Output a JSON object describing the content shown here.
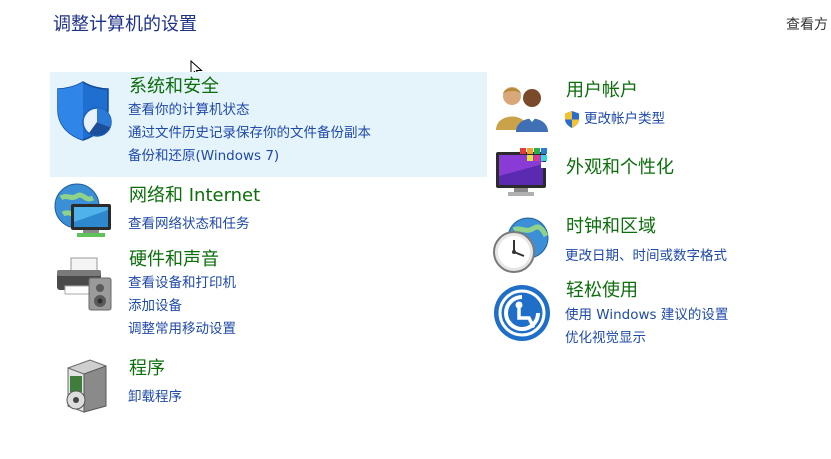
{
  "header": {
    "title": "调整计算机的设置",
    "view_by": "查看方"
  },
  "left": [
    {
      "title": "系统和安全",
      "icon": "security-shield-icon",
      "links": [
        "查看你的计算机状态",
        "通过文件历史记录保存你的文件备份副本",
        "备份和还原(Windows 7)"
      ]
    },
    {
      "title": "网络和 Internet",
      "icon": "network-globe-icon",
      "links": [
        "查看网络状态和任务"
      ]
    },
    {
      "title": "硬件和声音",
      "icon": "printer-speaker-icon",
      "links": [
        "查看设备和打印机",
        "添加设备",
        "调整常用移动设置"
      ]
    },
    {
      "title": "程序",
      "icon": "programs-box-icon",
      "links": [
        "卸载程序"
      ]
    }
  ],
  "right": [
    {
      "title": "用户帐户",
      "icon": "user-accounts-icon",
      "links": [
        "更改帐户类型"
      ]
    },
    {
      "title": "外观和个性化",
      "icon": "appearance-monitor-icon",
      "links": []
    },
    {
      "title": "时钟和区域",
      "icon": "clock-globe-icon",
      "links": [
        "更改日期、时间或数字格式"
      ]
    },
    {
      "title": "轻松使用",
      "icon": "ease-of-access-icon",
      "links": [
        "使用 Windows 建议的设置",
        "优化视觉显示"
      ]
    }
  ],
  "colors": {
    "title": "#1e3287",
    "category": "#0b6e0b",
    "link": "#1f4aa8",
    "hover_bg": "#e5f3fb"
  }
}
